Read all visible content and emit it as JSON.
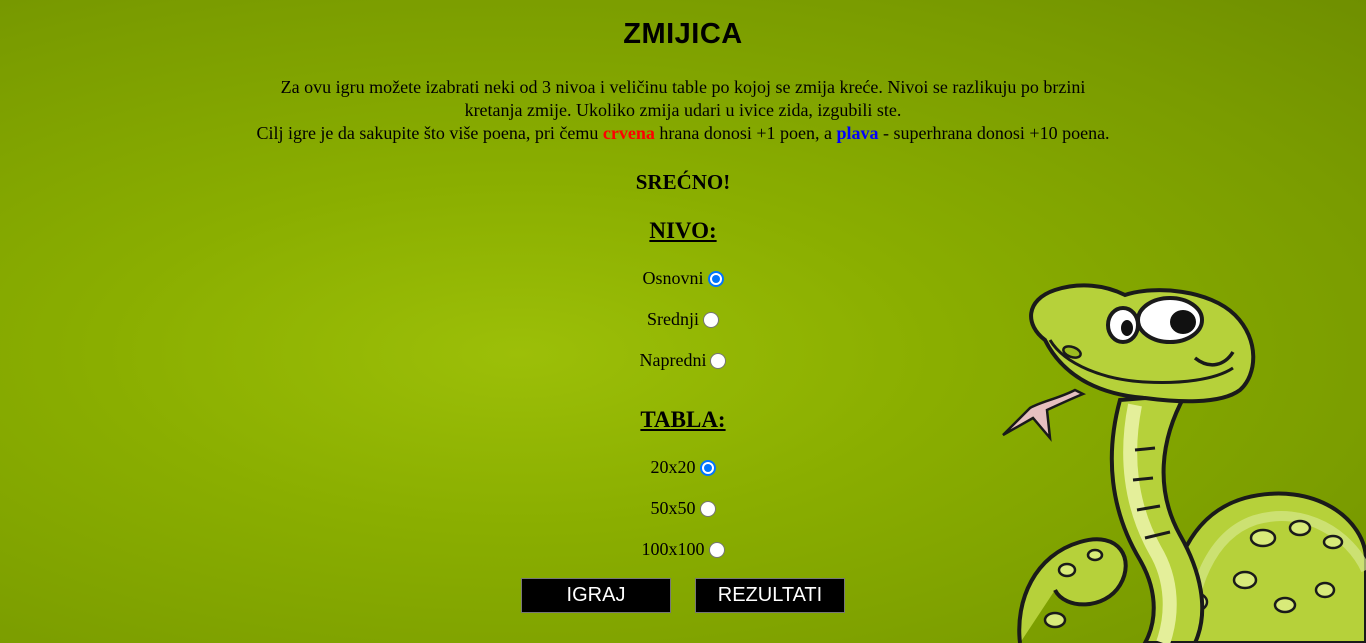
{
  "title": "ZMIJICA",
  "intro": {
    "line1": "Za ovu igru možete izabrati neki od 3 nivoa i veličinu table po kojoj se zmija kreće. Nivoi se razlikuju po brzini",
    "line2": "kretanja zmije. Ukoliko zmija udari u ivice zida, izgubili ste.",
    "line3_a": "Cilj igre je da sakupite što više poena, pri čemu ",
    "red_word": "crvena",
    "line3_b": " hrana donosi +1 poen, a ",
    "blue_word": "plava",
    "line3_c": " - superhrana donosi +10 poena."
  },
  "good_luck": "SREĆNO!",
  "level": {
    "heading": "NIVO:",
    "options": [
      {
        "label": "Osnovni",
        "checked": true
      },
      {
        "label": "Srednji",
        "checked": false
      },
      {
        "label": "Napredni",
        "checked": false
      }
    ]
  },
  "board": {
    "heading": "TABLA:",
    "options": [
      {
        "label": "20x20",
        "checked": true
      },
      {
        "label": "50x50",
        "checked": false
      },
      {
        "label": "100x100",
        "checked": false
      }
    ]
  },
  "buttons": {
    "play": "IGRAJ",
    "results": "REZULTATI"
  },
  "colors": {
    "accent_radio": "#0075ff",
    "food_red": "#ff0000",
    "superfood_blue": "#0000ff",
    "background": "#8aae00"
  },
  "icons": {
    "mascot": "cartoon-snake-illustration"
  }
}
